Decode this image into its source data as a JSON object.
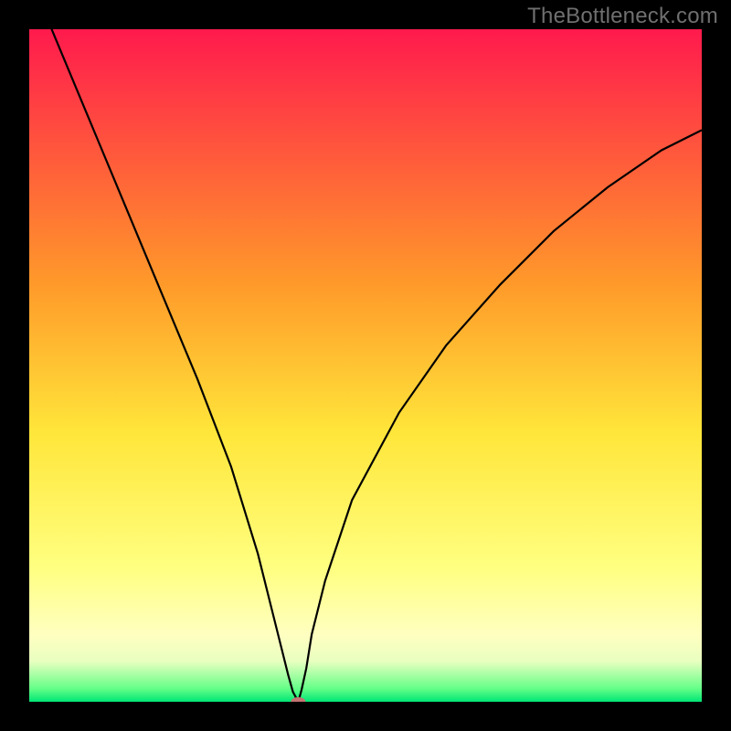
{
  "watermark": "TheBottleneck.com",
  "chart_data": {
    "type": "line",
    "title": "",
    "xlabel": "",
    "ylabel": "",
    "xlim": [
      0,
      100
    ],
    "ylim": [
      0,
      100
    ],
    "background_gradient": {
      "stops": [
        {
          "offset": 0,
          "color": "#ff1a4d"
        },
        {
          "offset": 38,
          "color": "#ff9a2a"
        },
        {
          "offset": 60,
          "color": "#ffe63a"
        },
        {
          "offset": 80,
          "color": "#ffff80"
        },
        {
          "offset": 90,
          "color": "#ffffc0"
        },
        {
          "offset": 94,
          "color": "#e8ffc0"
        },
        {
          "offset": 98,
          "color": "#66ff88"
        },
        {
          "offset": 100,
          "color": "#00e676"
        }
      ]
    },
    "series": [
      {
        "name": "bottleneck-curve",
        "color": "#000000",
        "stroke_width": 2.2,
        "x": [
          0,
          5,
          10,
          15,
          20,
          25,
          30,
          34,
          36,
          37.5,
          38.5,
          39.2,
          40.0,
          40.5,
          41.2,
          42.0,
          44.0,
          48.0,
          55.0,
          62.0,
          70.0,
          78.0,
          86.0,
          94.0,
          100.0
        ],
        "values": [
          108,
          96,
          84,
          72,
          60,
          48,
          35,
          22,
          14,
          8.0,
          4.0,
          1.5,
          0.0,
          1.8,
          5.0,
          10.0,
          18.0,
          30.0,
          43.0,
          53.0,
          62.0,
          70.0,
          76.5,
          82.0,
          85.0
        ]
      }
    ],
    "markers": [
      {
        "name": "min-marker",
        "x": 40.0,
        "y": 0.0,
        "rx": 8,
        "ry": 5,
        "color": "#c57272"
      }
    ]
  }
}
